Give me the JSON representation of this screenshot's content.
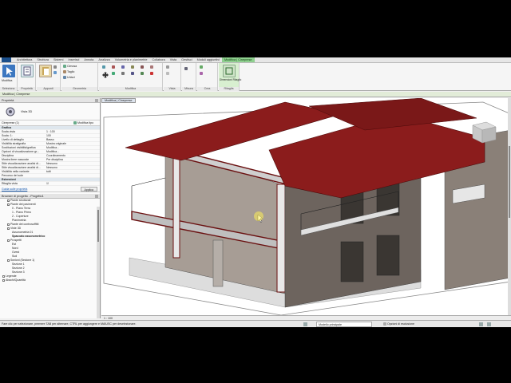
{
  "ribbon_tabs": [
    "Architettura",
    "Struttura",
    "Sistemi",
    "Inserisci",
    "Annota",
    "Analizza",
    "Volumetria e planimetrie",
    "Collabora",
    "Vista",
    "Gestisci",
    "Moduli aggiuntivi",
    "Modifica | Cineprese"
  ],
  "ribbon_groups": {
    "select_label": "Seleziona",
    "modify_label": "Modifica",
    "properties_label": "Proprietà",
    "clipboard_label": "Appunti",
    "geometry_label": "Geometria",
    "modify_group_label": "Modifica",
    "view_label": "Vista",
    "measure_label": "Misura",
    "create_label": "Crea",
    "dimensions_label": "Dimensioni Ritaglio",
    "crop_label": "Ritaglia",
    "cope_label": "Cimosa",
    "cut_label": "Taglio",
    "join_label": "Unisci",
    "paste_label": "Incolla"
  },
  "options_bar": {
    "label": "Modifica | Cineprese"
  },
  "properties": {
    "header": "Proprietà",
    "type_name": "Vista 3D",
    "instance": "Cineprese (1)",
    "edit_type": "Modifica tipo",
    "section_graphics": "Grafica",
    "rows": [
      {
        "k": "Scala vista",
        "v": "1 : 100"
      },
      {
        "k": "Scala: 1:",
        "v": "100"
      },
      {
        "k": "Livello di dettaglio",
        "v": "Basso"
      },
      {
        "k": "Visibilità stratigrafia",
        "v": "Mostra originale"
      },
      {
        "k": "Sostituzioni visibilità/grafica",
        "v": "Modifica..."
      },
      {
        "k": "Opzioni di visualizzazione gr...",
        "v": "Modifica..."
      },
      {
        "k": "Disciplina",
        "v": "Coordinamento"
      },
      {
        "k": "Mostra linee nascoste",
        "v": "Per disciplina"
      },
      {
        "k": "Stile visualizzazione analisi di...",
        "v": "Nessuno"
      },
      {
        "k": "Stile visualizzazione analisi di...",
        "v": "Nessuno"
      },
      {
        "k": "Visibilità nella variante",
        "v": "tutti"
      },
      {
        "k": "Percorso del sole",
        "v": ""
      }
    ],
    "section_extents": "Estensioni",
    "crop_row": "Ritaglia vista",
    "help_link": "Guida sulle proprietà",
    "apply": "Applica"
  },
  "browser": {
    "header": "Browser di progetto - Progetto1",
    "items": [
      {
        "label": "Piante strutturali",
        "lvl": 1
      },
      {
        "label": "Piante dei pavimenti",
        "lvl": 1
      },
      {
        "label": "0 - Piano Terra",
        "lvl": 2
      },
      {
        "label": "1 - Piano Primo",
        "lvl": 2
      },
      {
        "label": "2 - Coperture",
        "lvl": 2
      },
      {
        "label": "Planimetria",
        "lvl": 2
      },
      {
        "label": "Piante dei controsoffitti",
        "lvl": 1
      },
      {
        "label": "Viste 3D",
        "lvl": 1
      },
      {
        "label": "Assonometria 01",
        "lvl": 2
      },
      {
        "label": "Spaccato assonometrico",
        "lvl": 2,
        "bold": true
      },
      {
        "label": "Prospetti",
        "lvl": 1
      },
      {
        "label": "Est",
        "lvl": 2
      },
      {
        "label": "Nord",
        "lvl": 2
      },
      {
        "label": "Ovest",
        "lvl": 2
      },
      {
        "label": "Sud",
        "lvl": 2
      },
      {
        "label": "Sezioni (Sezione 1)",
        "lvl": 1
      },
      {
        "label": "Sezione 1",
        "lvl": 2
      },
      {
        "label": "Sezione 2",
        "lvl": 2
      },
      {
        "label": "Sezione 3",
        "lvl": 2
      },
      {
        "label": "Legende",
        "lvl": 0
      },
      {
        "label": "Abachi/Quantità",
        "lvl": 0
      }
    ]
  },
  "view": {
    "title": "Modifica | Cineprese",
    "scale": "1 : 100"
  },
  "status": {
    "hint": "Fare clic per selezionare, premere TAB per alternare, CTRL per aggiungere e MAIUSC per deselezionare.",
    "model": "Modello principale",
    "options": "Opzioni di esclusione"
  },
  "colors": {
    "roof": "#8b1c1c",
    "wall": "#8a8078",
    "context_tab": "#8fd08f"
  }
}
